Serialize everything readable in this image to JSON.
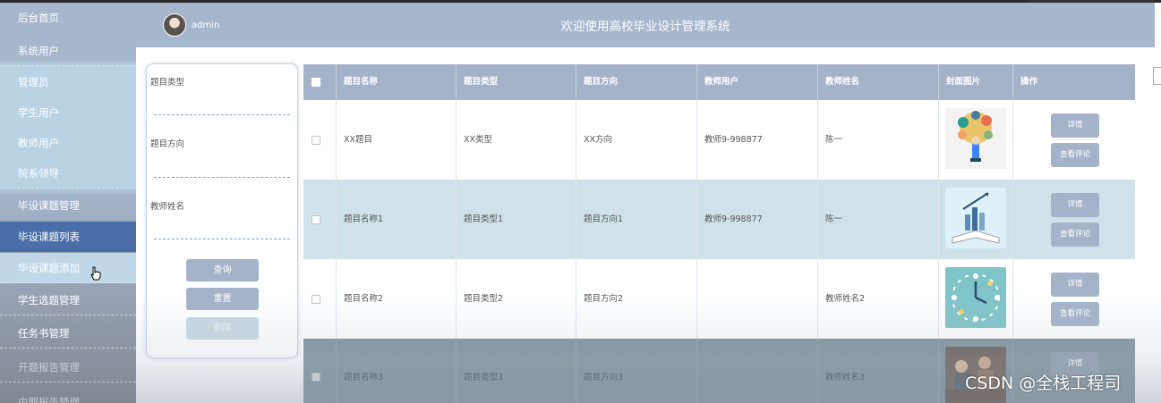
{
  "header": {
    "user": "admin",
    "title": "欢迎使用高校毕业设计管理系统"
  },
  "sidebar": {
    "items": [
      {
        "label": "后台首页",
        "key": "home"
      },
      {
        "label": "系统用户",
        "key": "sysuser"
      },
      {
        "label": "管理员",
        "key": "admin"
      },
      {
        "label": "学生用户",
        "key": "student"
      },
      {
        "label": "教师用户",
        "key": "teacher"
      },
      {
        "label": "院系领导",
        "key": "leader"
      },
      {
        "label": "毕设课题管理",
        "key": "topic-manage"
      },
      {
        "label": "毕设课题列表",
        "key": "topic-list"
      },
      {
        "label": "毕设课题添加",
        "key": "topic-add"
      },
      {
        "label": "学生选题管理",
        "key": "select-manage"
      },
      {
        "label": "任务书管理",
        "key": "task-manage"
      },
      {
        "label": "开题报告管理",
        "key": "proposal-manage"
      },
      {
        "label": "中期报告管理",
        "key": "midterm-manage"
      }
    ]
  },
  "filter": {
    "type_label": "题目类型",
    "direction_label": "题目方向",
    "teacher_label": "教师姓名",
    "query_button": "查询",
    "reset_button": "重置",
    "delete_button": "删除"
  },
  "table": {
    "columns": [
      "题目名称",
      "题目类型",
      "题目方向",
      "教师用户",
      "教师姓名",
      "封面图片",
      "操作"
    ],
    "rows": [
      {
        "name": "XX题目",
        "type": "XX类型",
        "direction": "XX方向",
        "teacher_user": "教师9-998877",
        "teacher_name": "陈一",
        "detail": "详情",
        "comments": "查看评论"
      },
      {
        "name": "题目名称1",
        "type": "题目类型1",
        "direction": "题目方向1",
        "teacher_user": "教师9-998877",
        "teacher_name": "陈一",
        "detail": "详情",
        "comments": "查看评论"
      },
      {
        "name": "题目名称2",
        "type": "题目类型2",
        "direction": "题目方向2",
        "teacher_user": "",
        "teacher_name": "教师姓名2",
        "detail": "详情",
        "comments": "查看评论"
      },
      {
        "name": "题目名称3",
        "type": "题目类型3",
        "direction": "题目方向3",
        "teacher_user": "",
        "teacher_name": "教师姓名3",
        "detail": "详情",
        "comments": ""
      }
    ]
  },
  "watermark": "CSDN @全栈工程司",
  "colors": {
    "header": "#a6b6cc",
    "active_menu": "#4a6fa8",
    "button": "#a5b3ca",
    "row_alt": "#cfe2ea"
  }
}
